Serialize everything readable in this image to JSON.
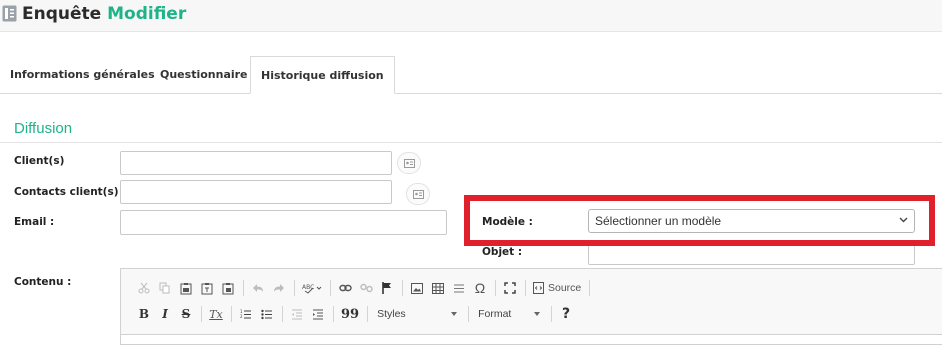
{
  "header": {
    "title_main": "Enquête",
    "title_accent": "Modifier",
    "icon": "document-icon"
  },
  "tabs": [
    {
      "label": "Informations générales",
      "active": false
    },
    {
      "label": "Questionnaire",
      "active": false
    },
    {
      "label": "Historique diffusion",
      "active": true
    }
  ],
  "section": {
    "title": "Diffusion"
  },
  "form": {
    "clients_label": "Client(s)",
    "contacts_label": "Contacts client(s)",
    "email_label": "Email :",
    "modele_label": "Modèle :",
    "modele_placeholder": "Sélectionner un modèle",
    "objet_label": "Objet :",
    "contenu_label": "Contenu :",
    "picker_icon": "address-card-icon"
  },
  "editor": {
    "toolbar_row1": [
      "cut-icon",
      "copy-icon",
      "paste-icon",
      "paste-text-icon",
      "paste-word-icon",
      "undo-icon",
      "redo-icon",
      "spellcheck-icon",
      "link-icon",
      "unlink-icon",
      "anchor-icon",
      "image-icon",
      "table-icon",
      "horizontal-rule-icon",
      "special-char-icon",
      "maximize-icon",
      "source-icon"
    ],
    "source_label": "Source",
    "bold_label": "B",
    "italic_label": "I",
    "strike_label": "S",
    "clear_format_label": "Tx",
    "quote_label": "99",
    "styles_label": "Styles",
    "format_label": "Format",
    "help_label": "?"
  },
  "colors": {
    "accent": "#1fb388",
    "highlight": "#e0202a"
  }
}
